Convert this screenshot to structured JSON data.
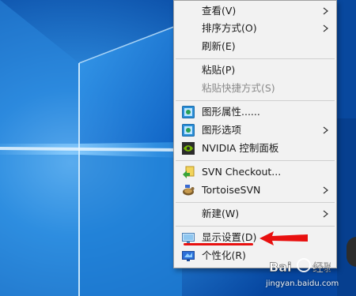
{
  "menu": {
    "items": [
      {
        "label": "查看(V)",
        "submenu": true
      },
      {
        "label": "排序方式(O)",
        "submenu": true
      },
      {
        "label": "刷新(E)",
        "submenu": false
      },
      {
        "label": "粘贴(P)",
        "submenu": false
      },
      {
        "label": "粘贴快捷方式(S)",
        "submenu": false,
        "disabled": true
      },
      {
        "label": "图形属性......",
        "icon": "intel-graphics-icon"
      },
      {
        "label": "图形选项",
        "icon": "intel-graphics-icon",
        "submenu": true
      },
      {
        "label": "NVIDIA 控制面板",
        "icon": "nvidia-icon"
      },
      {
        "label": "SVN Checkout...",
        "icon": "svn-checkout-icon"
      },
      {
        "label": "TortoiseSVN",
        "icon": "tortoise-svn-icon",
        "submenu": true
      },
      {
        "label": "新建(W)",
        "submenu": true
      },
      {
        "label": "显示设置(D)",
        "icon": "display-settings-icon"
      },
      {
        "label": "个性化(R)",
        "icon": "personalize-icon"
      }
    ]
  },
  "watermark": {
    "text": "jingyan.baidu.com"
  },
  "colors": {
    "desktop_blue": "#0b5fb5",
    "menu_bg": "#f2f2f2",
    "annotation_red": "#e8100f"
  }
}
